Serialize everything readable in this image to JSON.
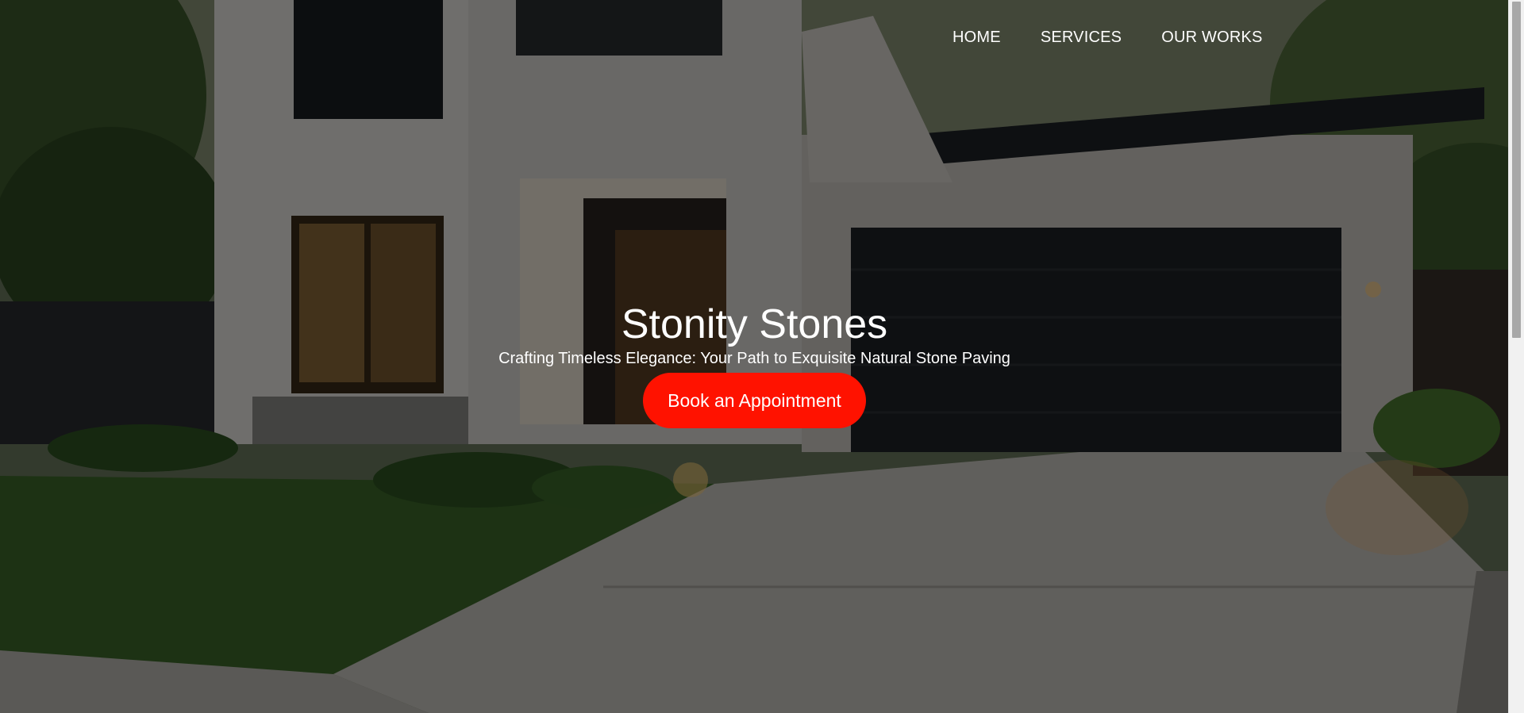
{
  "nav": {
    "items": [
      {
        "label": "HOME"
      },
      {
        "label": "SERVICES"
      },
      {
        "label": "OUR WORKS"
      }
    ]
  },
  "hero": {
    "title": "Stonity Stones",
    "subtitle": "Crafting Timeless Elegance: Your Path to Exquisite Natural Stone Paving",
    "cta_label": "Book an Appointment",
    "background_icon": "modern-house-photo"
  },
  "colors": {
    "accent": "#ff1200",
    "text": "#ffffff",
    "overlay": "rgba(0,0,0,0.52)"
  }
}
